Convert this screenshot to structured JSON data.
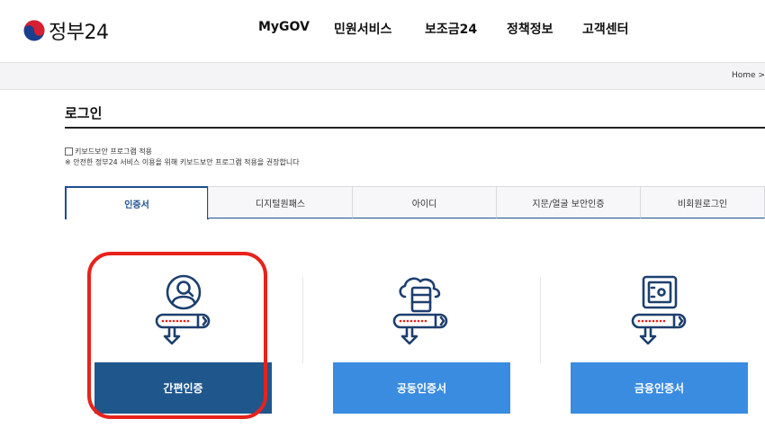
{
  "brand": {
    "logo_text": "정부24"
  },
  "nav": {
    "items": [
      {
        "label": "MyGOV"
      },
      {
        "label": "민원서비스"
      },
      {
        "label": "보조금24"
      },
      {
        "label": "정책정보"
      },
      {
        "label": "고객센터"
      }
    ]
  },
  "breadcrumb": {
    "text": "Home >"
  },
  "page": {
    "title": "로그인"
  },
  "security": {
    "checkbox_label": "키보드보안 프로그램 적용",
    "checked": false,
    "note": "※ 안전한 정부24 서비스 이용을 위해 키보드보안 프로그램 적용을 권장합니다"
  },
  "tabs": [
    {
      "label": "인증서",
      "active": true
    },
    {
      "label": "디지털원패스",
      "active": false
    },
    {
      "label": "아이디",
      "active": false
    },
    {
      "label": "지문/얼굴 보안인증",
      "active": false
    },
    {
      "label": "비회원로그인",
      "active": false
    }
  ],
  "cards": [
    {
      "icon": "user-login-icon",
      "button_label": "간편인증",
      "style": "dark",
      "highlighted": true
    },
    {
      "icon": "cloud-server-login-icon",
      "button_label": "공동인증서",
      "style": "light",
      "highlighted": false
    },
    {
      "icon": "safe-login-icon",
      "button_label": "금융인증서",
      "style": "light",
      "highlighted": false
    }
  ],
  "colors": {
    "primary_dark": "#1f568c",
    "primary_light": "#3a8ce0",
    "tab_active": "#1e4e8c",
    "highlight": "#e8221b",
    "icon_stroke": "#1d3f6e",
    "password_dots": "#e8221b"
  }
}
